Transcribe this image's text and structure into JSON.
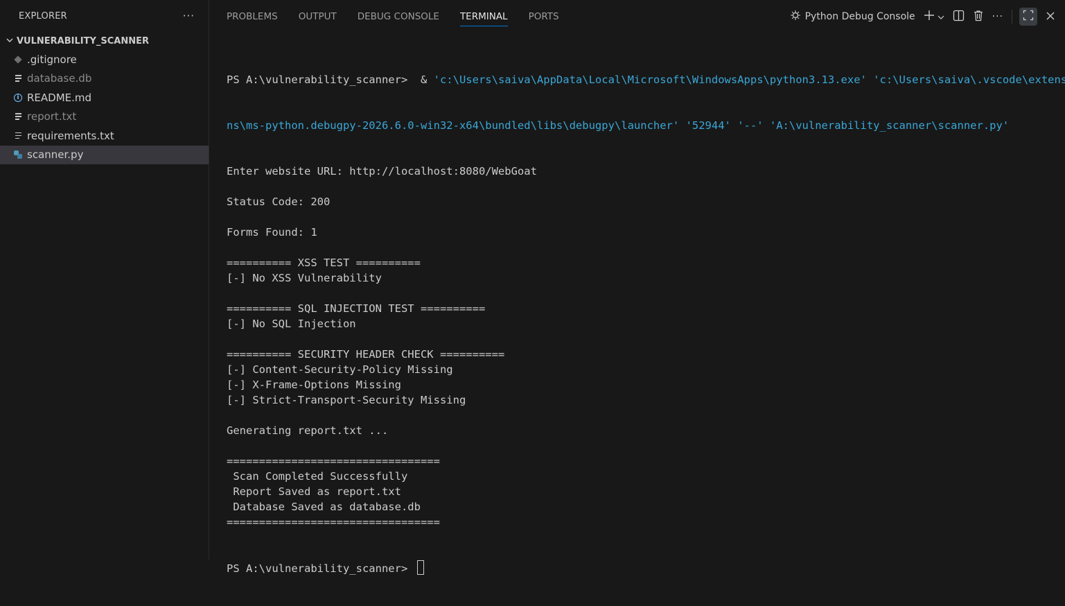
{
  "sidebar": {
    "title": "EXPLORER",
    "more_label": "···",
    "folder": "VULNERABILITY_SCANNER",
    "files": [
      {
        "name": ".gitignore",
        "icon": "git-icon",
        "color": "#cccccc"
      },
      {
        "name": "database.db",
        "icon": "file-lines-icon",
        "color": "#8b8b8b"
      },
      {
        "name": "README.md",
        "icon": "info-icon",
        "color": "#cccccc"
      },
      {
        "name": "report.txt",
        "icon": "file-lines-icon",
        "color": "#8b8b8b"
      },
      {
        "name": "requirements.txt",
        "icon": "file-lines-icon",
        "color": "#cccccc"
      },
      {
        "name": "scanner.py",
        "icon": "python-icon",
        "color": "#cccccc"
      }
    ]
  },
  "panel": {
    "tabs": [
      "PROBLEMS",
      "OUTPUT",
      "DEBUG CONSOLE",
      "TERMINAL",
      "PORTS"
    ],
    "active_tab": "TERMINAL",
    "terminal_name": "Python Debug Console"
  },
  "terminal": {
    "prompt": "PS A:\\vulnerability_scanner>",
    "command_amp": "  & ",
    "command_line1": "'c:\\Users\\saiva\\AppData\\Local\\Microsoft\\WindowsApps\\python3.13.exe' 'c:\\Users\\saiva\\.vscode\\extensio",
    "command_line2": "ns\\ms-python.debugpy-2026.6.0-win32-x64\\bundled\\libs\\debugpy\\launcher' '52944' '--' 'A:\\vulnerability_scanner\\scanner.py'",
    "output": [
      "Enter website URL: http://localhost:8080/WebGoat",
      "",
      "Status Code: 200",
      "",
      "Forms Found: 1",
      "",
      "========== XSS TEST ==========",
      "[-] No XSS Vulnerability",
      "",
      "========== SQL INJECTION TEST ==========",
      "[-] No SQL Injection",
      "",
      "========== SECURITY HEADER CHECK ==========",
      "[-] Content-Security-Policy Missing",
      "[-] X-Frame-Options Missing",
      "[-] Strict-Transport-Security Missing",
      "",
      "Generating report.txt ...",
      "",
      "=================================",
      " Scan Completed Successfully",
      " Report Saved as report.txt",
      " Database Saved as database.db",
      "================================="
    ],
    "final_prompt": "PS A:\\vulnerability_scanner> "
  },
  "colors": {
    "background": "#181818",
    "accent": "#0078d4",
    "command_highlight": "#3aa7d7"
  }
}
